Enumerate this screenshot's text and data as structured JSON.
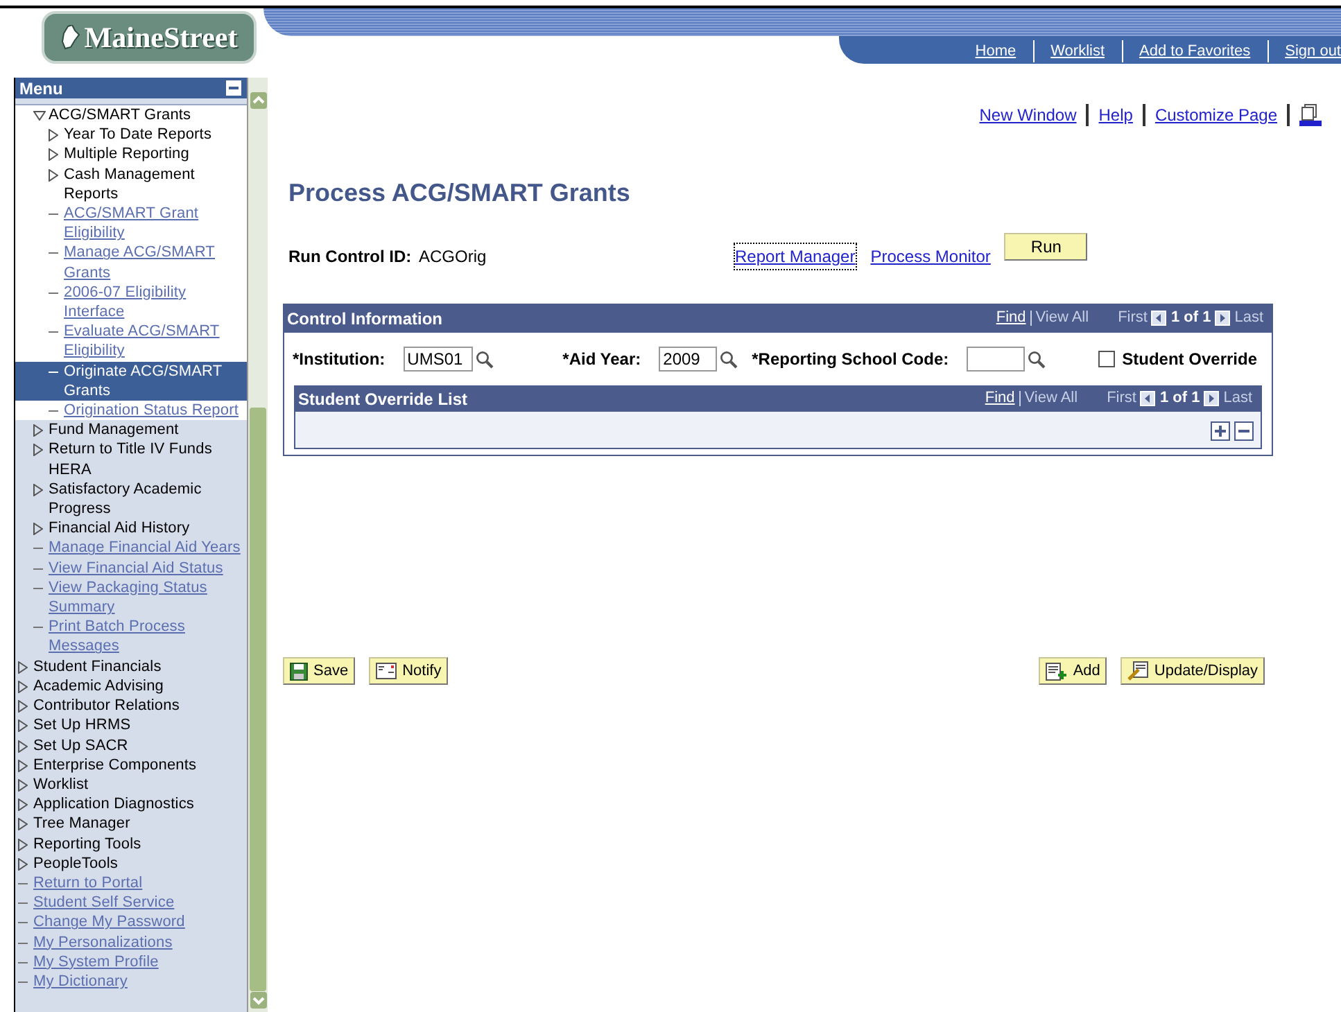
{
  "logo": {
    "text": "MaineStreet"
  },
  "nav_links": [
    "Home",
    "Worklist",
    "Add to Favorites",
    "Sign out"
  ],
  "menu": {
    "title": "Menu",
    "sub_items": [
      {
        "label": "ACG/SMART Grants",
        "kind": "folder",
        "expanded": true,
        "selected": false,
        "children": [
          {
            "label": "Year To Date Reports",
            "kind": "folder",
            "expanded": false,
            "selected": false
          },
          {
            "label": "Multiple Reporting",
            "kind": "folder",
            "expanded": false,
            "selected": false
          },
          {
            "label": "Cash Management Reports",
            "kind": "folder",
            "expanded": false,
            "selected": false
          },
          {
            "label": "ACG/SMART Grant Eligibility",
            "kind": "link",
            "selected": false
          },
          {
            "label": "Manage ACG/SMART Grants",
            "kind": "link",
            "selected": false
          },
          {
            "label": "2006-07 Eligibility Interface",
            "kind": "link",
            "selected": false
          },
          {
            "label": "Evaluate ACG/SMART Eligibility",
            "kind": "link",
            "selected": false
          },
          {
            "label": "Originate ACG/SMART Grants",
            "kind": "link",
            "selected": true
          },
          {
            "label": "Origination Status Report",
            "kind": "link",
            "selected": false
          }
        ]
      },
      {
        "label": "Fund Management",
        "kind": "folder",
        "expanded": false,
        "selected": false
      },
      {
        "label": "Return to Title IV Funds HERA",
        "kind": "folder",
        "expanded": false,
        "selected": false
      },
      {
        "label": "Satisfactory Academic Progress",
        "kind": "folder",
        "expanded": false,
        "selected": false
      },
      {
        "label": "Financial Aid History",
        "kind": "folder",
        "expanded": false,
        "selected": false
      },
      {
        "label": "Manage Financial Aid Years",
        "kind": "link",
        "selected": false
      },
      {
        "label": "View Financial Aid Status",
        "kind": "link",
        "selected": false
      },
      {
        "label": "View Packaging Status Summary",
        "kind": "link",
        "selected": false
      },
      {
        "label": "Print Batch Process Messages",
        "kind": "link",
        "selected": false
      }
    ],
    "items": [
      {
        "label": "Student Financials",
        "kind": "folder",
        "expanded": false,
        "selected": false
      },
      {
        "label": "Academic Advising",
        "kind": "folder",
        "expanded": false,
        "selected": false
      },
      {
        "label": "Contributor Relations",
        "kind": "folder",
        "expanded": false,
        "selected": false
      },
      {
        "label": "Set Up HRMS",
        "kind": "folder",
        "expanded": false,
        "selected": false
      },
      {
        "label": "Set Up SACR",
        "kind": "folder",
        "expanded": false,
        "selected": false
      },
      {
        "label": "Enterprise Components",
        "kind": "folder",
        "expanded": false,
        "selected": false
      },
      {
        "label": "Worklist",
        "kind": "folder",
        "expanded": false,
        "selected": false
      },
      {
        "label": "Application Diagnostics",
        "kind": "folder",
        "expanded": false,
        "selected": false
      },
      {
        "label": "Tree Manager",
        "kind": "folder",
        "expanded": false,
        "selected": false
      },
      {
        "label": "Reporting Tools",
        "kind": "folder",
        "expanded": false,
        "selected": false
      },
      {
        "label": "PeopleTools",
        "kind": "folder",
        "expanded": false,
        "selected": false
      },
      {
        "label": "Return to Portal",
        "kind": "link",
        "selected": false
      },
      {
        "label": "Student Self Service",
        "kind": "link",
        "selected": false
      },
      {
        "label": "Change My Password",
        "kind": "link",
        "selected": false
      },
      {
        "label": "My Personalizations",
        "kind": "link",
        "selected": false
      },
      {
        "label": "My System Profile",
        "kind": "link",
        "selected": false
      },
      {
        "label": "My Dictionary",
        "kind": "link",
        "selected": false
      }
    ]
  },
  "toolbar_links": [
    "New Window",
    "Help",
    "Customize Page"
  ],
  "title": "Process ACG/SMART Grants",
  "run_control": {
    "label": "Run Control ID:",
    "value": "ACGOrig"
  },
  "process_links": [
    "Report Manager",
    "Process Monitor"
  ],
  "run_button": "Run",
  "control_panel": {
    "title": "Control Information",
    "nav": {
      "find": "Find",
      "view_all": "View All",
      "first": "First",
      "count": "1 of 1",
      "last": "Last"
    },
    "fields": [
      {
        "label": "*Institution:",
        "value": "UMS01"
      },
      {
        "label": "*Aid Year:",
        "value": "2009"
      },
      {
        "label": "*Reporting School Code:"
      }
    ],
    "checkbox": {
      "label": "Student Override",
      "checked": false
    },
    "grid": {
      "title": "Student Override List",
      "nav": {
        "find": "Find",
        "view_all": "View All",
        "first": "First",
        "count": "1 of 1",
        "last": "Last"
      }
    }
  },
  "buttons_left": [
    {
      "label": "Save",
      "kind": "save"
    },
    {
      "label": "Notify",
      "kind": "notify"
    }
  ],
  "buttons_right": [
    {
      "label": "Add",
      "kind": "add"
    },
    {
      "label": "Update/Display",
      "kind": "update"
    }
  ]
}
